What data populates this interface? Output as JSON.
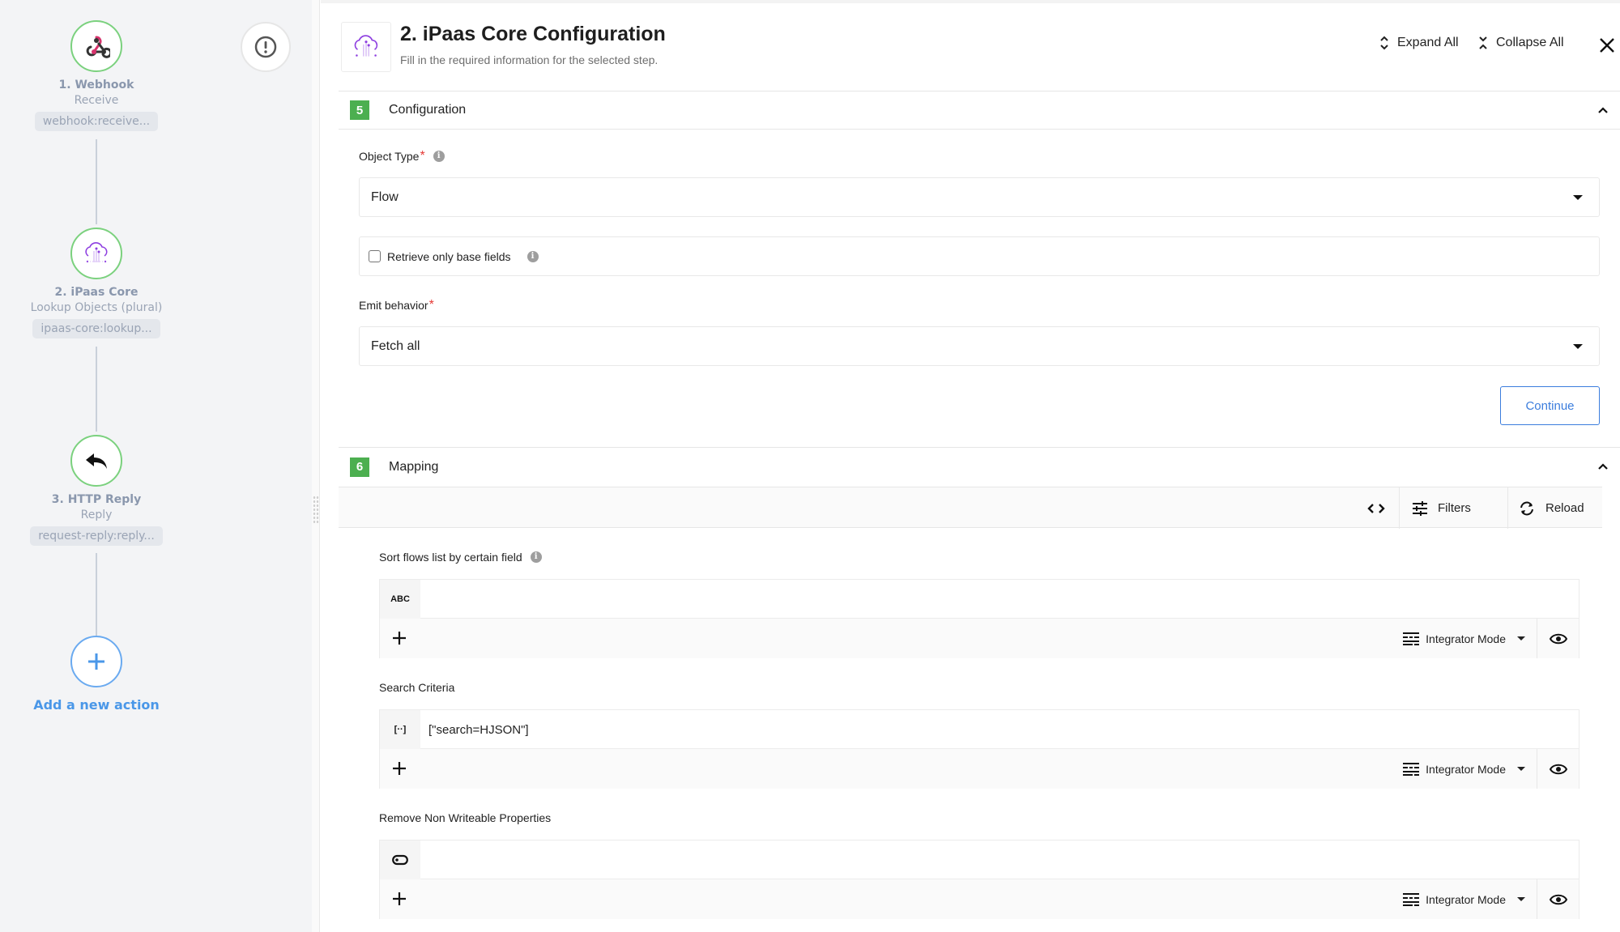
{
  "flow": {
    "alert_icon": "alert-circle-icon",
    "nodes": [
      {
        "title": "1. Webhook",
        "subtitle": "Receive",
        "tag": "webhook:receive...",
        "icon": "webhook-icon"
      },
      {
        "title": "2. iPaas Core",
        "subtitle": "Lookup Objects (plural)",
        "tag": "ipaas-core:lookup...",
        "icon": "cloud-network-icon"
      },
      {
        "title": "3. HTTP Reply",
        "subtitle": "Reply",
        "tag": "request-reply:reply...",
        "icon": "reply-arrow-icon"
      }
    ],
    "add_action_label": "Add a new action"
  },
  "header": {
    "title": "2. iPaas Core Configuration",
    "subtitle": "Fill in the required information for the selected step.",
    "expand_all": "Expand All",
    "collapse_all": "Collapse All"
  },
  "configuration": {
    "step_number": "5",
    "title": "Configuration",
    "object_type_label": "Object Type",
    "object_type_value": "Flow",
    "retrieve_base_label": "Retrieve only base fields",
    "retrieve_base_checked": false,
    "emit_label": "Emit behavior",
    "emit_value": "Fetch all",
    "required_mark": "*",
    "info_glyph": "i",
    "continue_label": "Continue"
  },
  "mapping": {
    "step_number": "6",
    "title": "Mapping",
    "toolbar": {
      "filters": "Filters",
      "reload": "Reload"
    },
    "fields": [
      {
        "label": "Sort flows list by certain field",
        "type_badge": "ABC",
        "type": "string",
        "value": "",
        "has_info": true,
        "mode": "Integrator Mode"
      },
      {
        "label": "Search Criteria",
        "type_badge": "[··]",
        "type": "array",
        "value": "[\"search=HJSON\"]",
        "has_info": false,
        "mode": "Integrator Mode"
      },
      {
        "label": "Remove Non Writeable Properties",
        "type_badge": "",
        "type": "boolean",
        "value": "",
        "has_info": false,
        "mode": "Integrator Mode"
      }
    ]
  },
  "colors": {
    "badge_green": "#4caf50",
    "node_ring": "#7bd17e",
    "link_blue": "#4a97e8",
    "required_red": "#e53935",
    "continue_blue": "#3b7ddd"
  }
}
